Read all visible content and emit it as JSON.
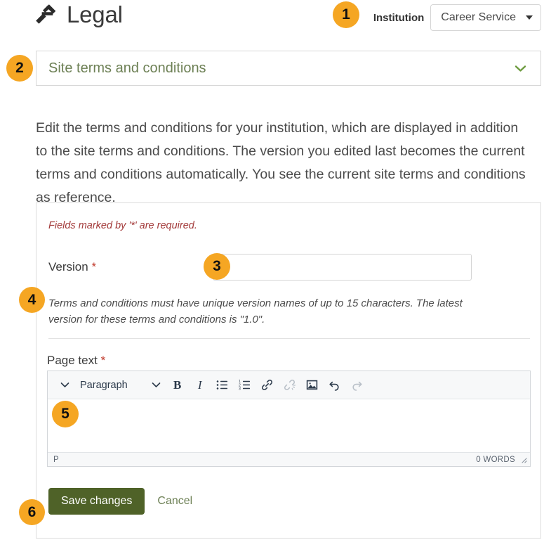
{
  "header": {
    "icon": "gavel-icon",
    "title": "Legal",
    "institution_label": "Institution",
    "institution_value": "Career Service",
    "institution_options": [
      "Career Service"
    ]
  },
  "collapsible": {
    "label": "Site terms and conditions",
    "chevron": "chevron-down-icon"
  },
  "description": "Edit the terms and conditions for your institution, which are displayed in addition to the site terms and conditions. The version you edited last becomes the current terms and conditions automatically. You see the current site terms and conditions as reference.",
  "form": {
    "required_note": "Fields marked by '*' are required.",
    "version": {
      "label": "Version",
      "required_marker": "*",
      "value": "",
      "placeholder": "",
      "hint": "Terms and conditions must have unique version names of up to 15 characters. The latest version for these terms and conditions is \"1.0\"."
    },
    "page_text": {
      "label": "Page text",
      "required_marker": "*",
      "value": "",
      "toolbar": {
        "collapse_toggle": "chevron-down-icon",
        "format_select_value": "Paragraph",
        "format_select_caret": "chevron-down-icon",
        "bold": "B",
        "italic": "I",
        "bullet_list": "bullet-list-icon",
        "numbered_list": "numbered-list-icon",
        "link": "link-icon",
        "unlink": "unlink-icon",
        "image": "image-icon",
        "undo": "undo-icon",
        "redo": "redo-icon"
      },
      "status": {
        "element_path": "P",
        "word_count": "0 WORDS",
        "resize": "resize-grip-icon"
      }
    },
    "save_label": "Save changes",
    "cancel_label": "Cancel"
  },
  "callouts": [
    {
      "number": "1",
      "target": "institution-selector"
    },
    {
      "number": "2",
      "target": "site-terms-collapsible"
    },
    {
      "number": "3",
      "target": "version-input"
    },
    {
      "number": "4",
      "target": "version-hint"
    },
    {
      "number": "5",
      "target": "page-text-editor-body"
    },
    {
      "number": "6",
      "target": "save-changes-button"
    }
  ],
  "colors": {
    "badge": "#F5A623",
    "accent_green": "#6d8055",
    "save_button": "#4f6228",
    "required_red": "#a33a3a"
  }
}
